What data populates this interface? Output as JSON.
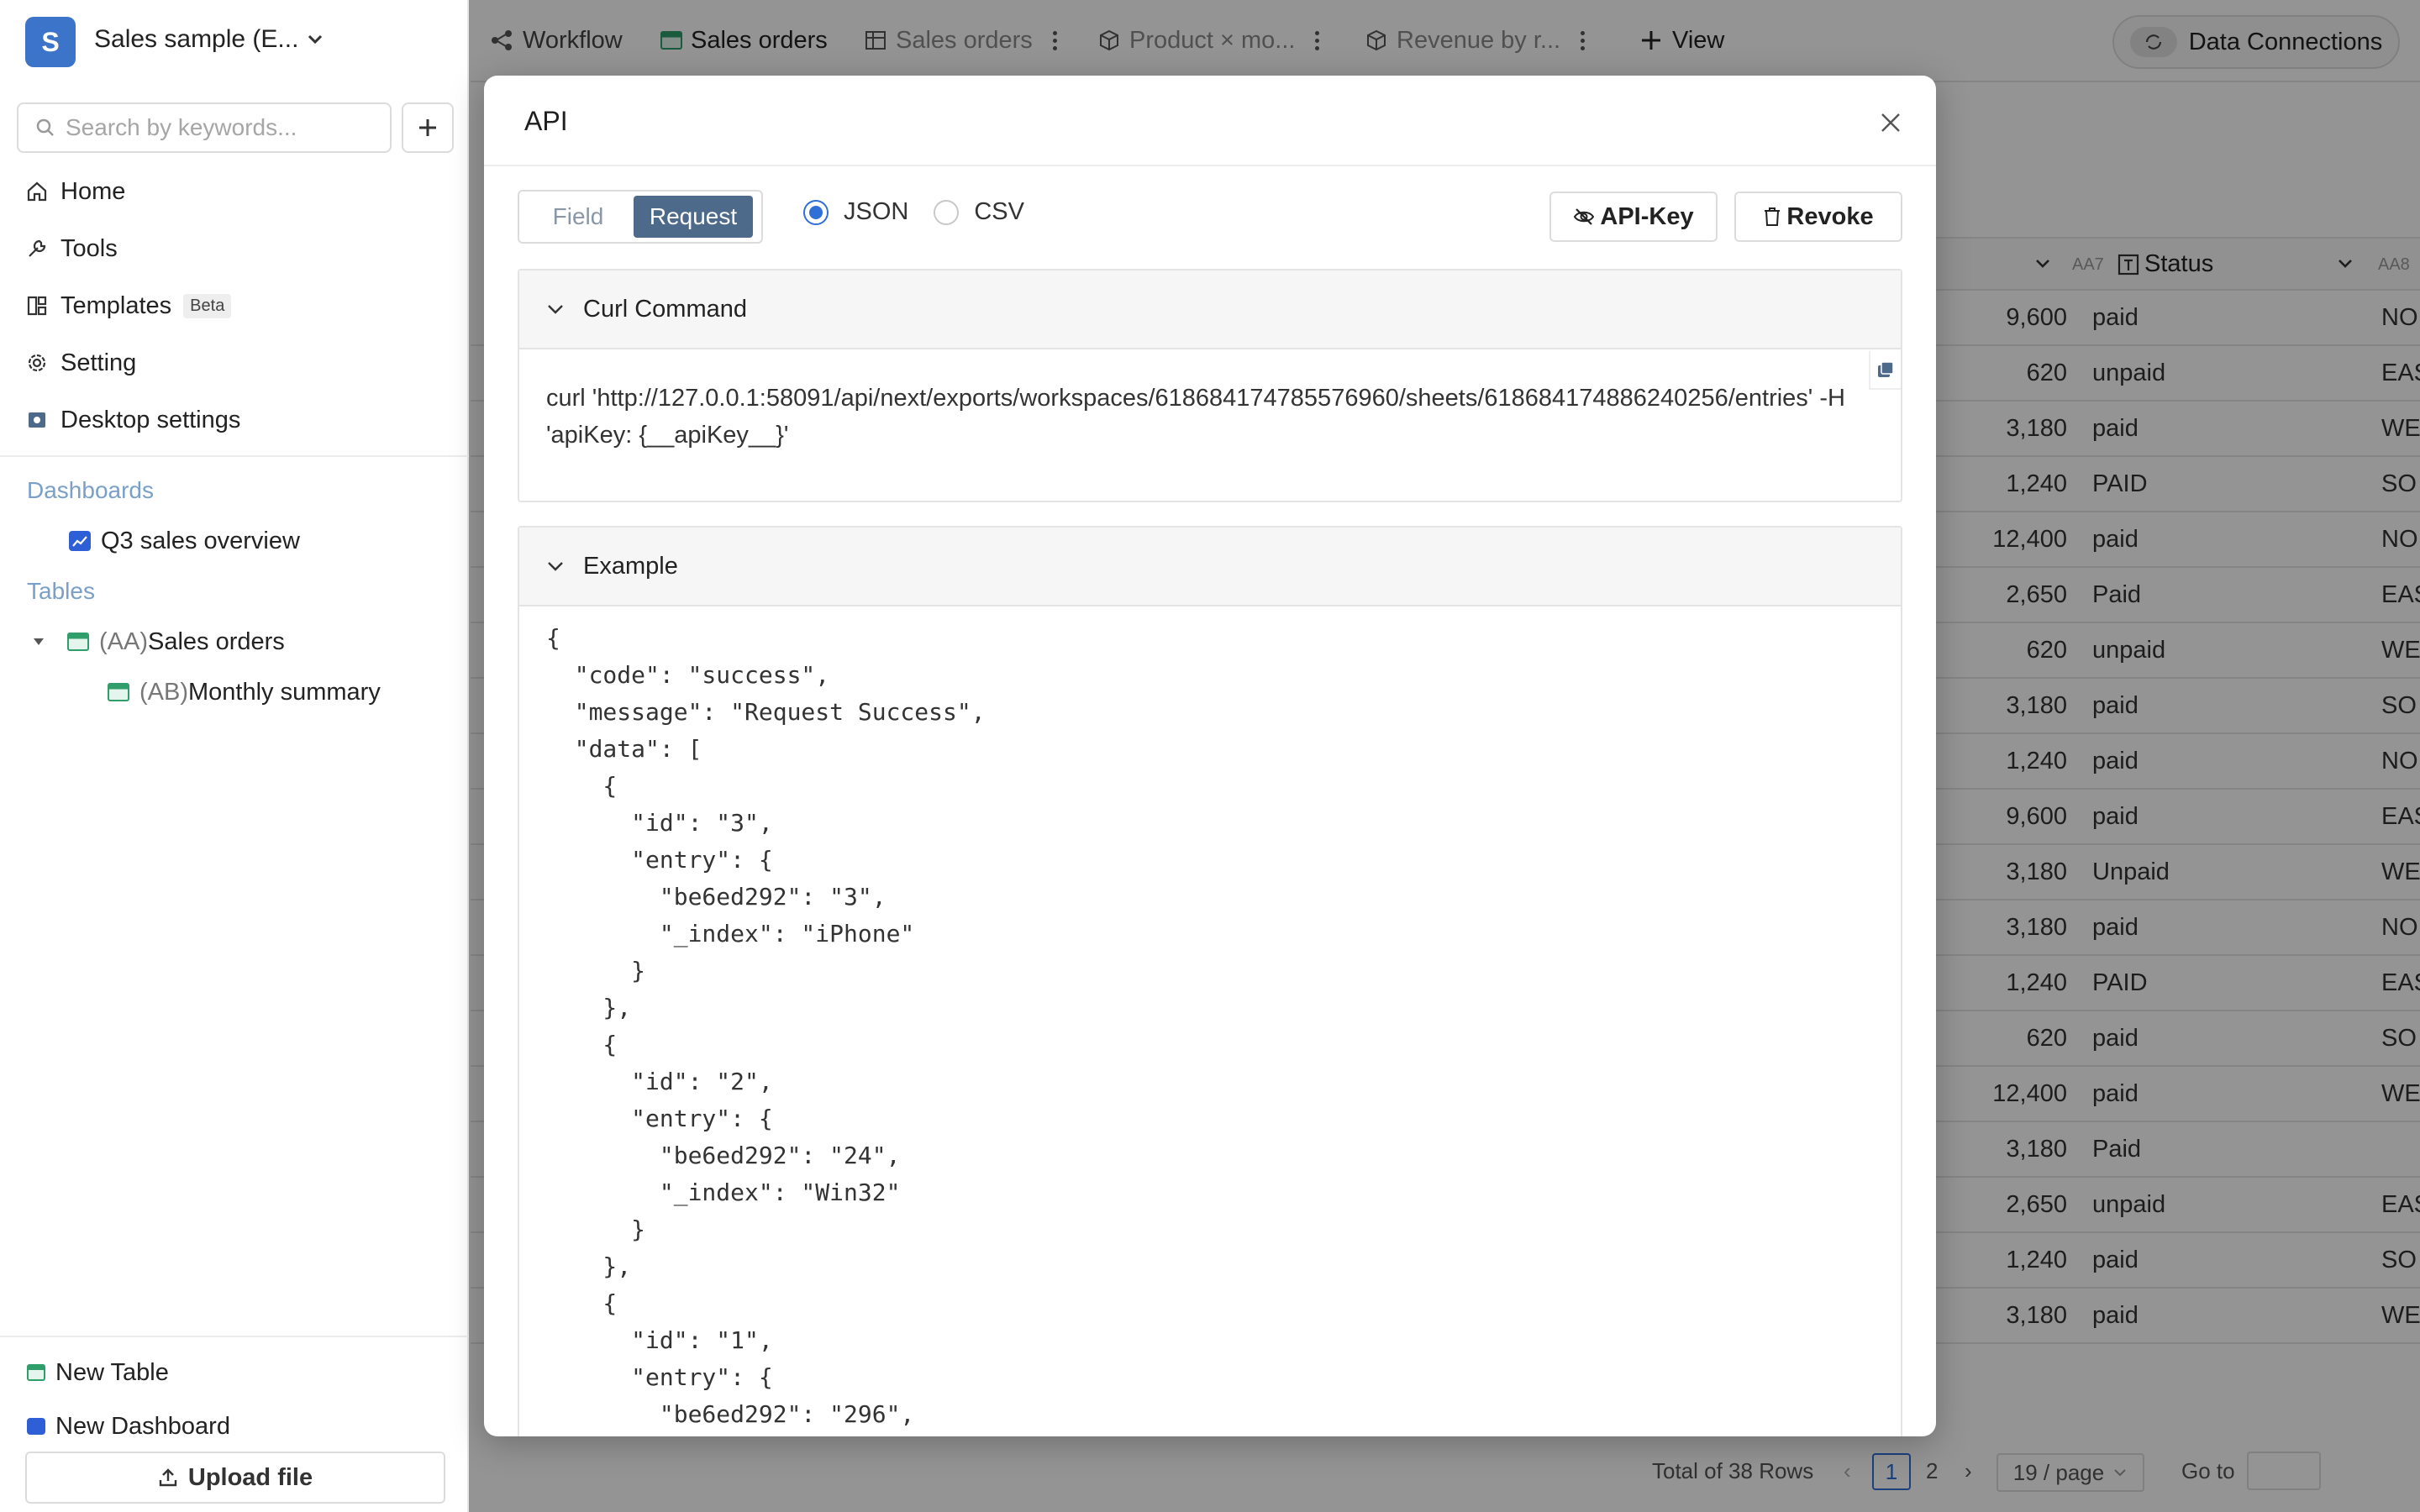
{
  "workspace": {
    "initial": "S",
    "name": "Sales sample (E..."
  },
  "sidebar": {
    "search_placeholder": "Search by keywords...",
    "nav": [
      {
        "label": "Home"
      },
      {
        "label": "Tools"
      },
      {
        "label": "Templates",
        "badge": "Beta"
      },
      {
        "label": "Setting"
      },
      {
        "label": "Desktop settings"
      }
    ],
    "dashboards_title": "Dashboards",
    "dashboards": [
      {
        "label": "Q3 sales overview"
      }
    ],
    "tables_title": "Tables",
    "tables": [
      {
        "prefix": "(AA)",
        "label": "Sales orders"
      },
      {
        "prefix": "(AB)",
        "label": "Monthly summary"
      }
    ],
    "new_table": "New Table",
    "new_dashboard": "New Dashboard",
    "upload": "Upload file"
  },
  "tabs": {
    "workflow": "Workflow",
    "sales_orders": "Sales orders",
    "sales_orders_2": "Sales orders",
    "product": "Product × mo...",
    "revenue": "Revenue by r...",
    "view": "View",
    "data_connections": "Data Connections"
  },
  "grid": {
    "col_aa7": "AA7",
    "status_header": "Status",
    "col_aa8": "AA8",
    "rows": [
      {
        "amount": "9,600",
        "status": "paid",
        "region": "NO"
      },
      {
        "amount": "620",
        "status": "unpaid",
        "region": "EAS"
      },
      {
        "amount": "3,180",
        "status": "paid",
        "region": "WE"
      },
      {
        "amount": "1,240",
        "status": "PAID",
        "region": "SO"
      },
      {
        "amount": "12,400",
        "status": "paid",
        "region": "NO"
      },
      {
        "amount": "2,650",
        "status": "Paid",
        "region": "EAS"
      },
      {
        "amount": "620",
        "status": "unpaid",
        "region": "WE"
      },
      {
        "amount": "3,180",
        "status": "paid",
        "region": "SO"
      },
      {
        "amount": "1,240",
        "status": "paid",
        "region": "NO"
      },
      {
        "amount": "9,600",
        "status": "paid",
        "region": "EAS"
      },
      {
        "amount": "3,180",
        "status": "Unpaid",
        "region": "WE"
      },
      {
        "amount": "3,180",
        "status": "paid",
        "region": "NO"
      },
      {
        "amount": "1,240",
        "status": "PAID",
        "region": "EAS"
      },
      {
        "amount": "620",
        "status": "paid",
        "region": "SO"
      },
      {
        "amount": "12,400",
        "status": "paid",
        "region": "WE"
      },
      {
        "amount": "3,180",
        "status": "Paid",
        "region": ""
      },
      {
        "amount": "2,650",
        "status": "unpaid",
        "region": "EAS"
      },
      {
        "amount": "1,240",
        "status": "paid",
        "region": "SO"
      },
      {
        "amount": "3,180",
        "status": "paid",
        "region": "WE"
      }
    ]
  },
  "footer": {
    "total": "Total of 38 Rows",
    "page1": "1",
    "page2": "2",
    "per_page": "19 / page",
    "goto": "Go to"
  },
  "modal": {
    "title": "API",
    "seg_field": "Field",
    "seg_request": "Request",
    "radio_json": "JSON",
    "radio_csv": "CSV",
    "api_key": "API-Key",
    "revoke": "Revoke",
    "curl_title": "Curl Command",
    "curl_text": "curl 'http://127.0.0.1:58091/api/next/exports/workspaces/618684174785576960/sheets/618684174886240256/entries' -H 'apiKey: {__apiKey__}'",
    "example_title": "Example",
    "example_code": "{\n  \"code\": \"success\",\n  \"message\": \"Request Success\",\n  \"data\": [\n    {\n      \"id\": \"3\",\n      \"entry\": {\n        \"be6ed292\": \"3\",\n        \"_index\": \"iPhone\"\n      }\n    },\n    {\n      \"id\": \"2\",\n      \"entry\": {\n        \"be6ed292\": \"24\",\n        \"_index\": \"Win32\"\n      }\n    },\n    {\n      \"id\": \"1\",\n      \"entry\": {\n        \"be6ed292\": \"296\","
  }
}
